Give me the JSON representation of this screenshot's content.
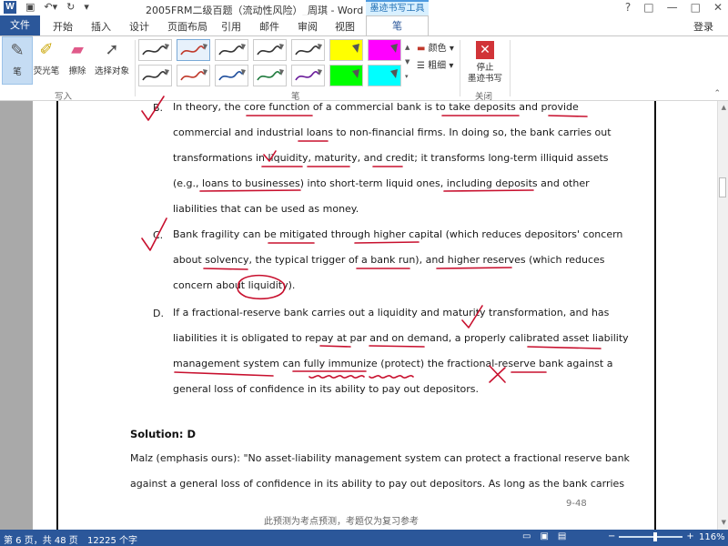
{
  "titlebar": {
    "title": "2005FRM二级百题（流动性风险）_周琪 - Word",
    "context_tool_label": "墨迹书写工具",
    "help": "?",
    "restore": "□",
    "minimize": "—",
    "maximize": "□",
    "close": "✕"
  },
  "tabs": {
    "file": "文件",
    "home": "开始",
    "insert": "插入",
    "design": "设计",
    "layout": "页面布局",
    "references": "引用",
    "mailings": "邮件",
    "review": "审阅",
    "view": "视图",
    "pen": "笔",
    "login": "登录"
  },
  "ribbon": {
    "write_group": {
      "pen": "笔",
      "highlighter": "荧光笔",
      "eraser": "擦除",
      "select_objects": "选择对象",
      "group_label": "写入"
    },
    "pens_group": {
      "color": "颜色",
      "thickness": "粗细",
      "group_label": "笔"
    },
    "close_group": {
      "stop_inking_line1": "停止",
      "stop_inking_line2": "墨迹书写",
      "group_label": "关闭"
    },
    "pen_colors": [
      "#333333",
      "#c0392b",
      "#333333",
      "#333333",
      "#333333",
      "#ffff00",
      "#ff00ff",
      "#333333",
      "#c0392b",
      "#1f4e9c",
      "#1e7a3c",
      "#6a1b9a",
      "#00ff00",
      "#00ffff"
    ]
  },
  "document": {
    "item_b": {
      "letter": "B.",
      "lines": [
        "In theory, the core function of a commercial bank is to take deposits and provide",
        "commercial and industrial loans to non-financial firms. In doing so, the bank carries out",
        "transformations in liquidity, maturity, and credit; it transforms long-term illiquid assets",
        "(e.g., loans to businesses) into short-term liquid ones, including deposits and other",
        "liabilities that can be used as money."
      ]
    },
    "item_c": {
      "letter": "C.",
      "lines": [
        "Bank fragility can be mitigated through higher capital (which reduces depositors' concern",
        "about solvency, the typical trigger of a bank run), and higher reserves (which reduces",
        "concern about liquidity)."
      ]
    },
    "item_d": {
      "letter": "D.",
      "lines": [
        "If a fractional-reserve bank carries out a liquidity and maturity transformation, and has",
        "liabilities it is obligated to repay at par and on demand, a properly calibrated asset liability",
        "management system can fully immunize (protect) the fractional-reserve bank against a",
        "general loss of confidence in its ability to pay out depositors."
      ]
    },
    "solution": "Solution: D",
    "malz_lines": [
      "Malz (emphasis ours): \"No asset-liability management system can protect a fractional reserve bank",
      "against a general loss of confidence in its ability to pay out depositors. As long as the bank carries"
    ],
    "page_number": "9-48",
    "footer": "此预测为考点预测，考题仅为复习参考"
  },
  "statusbar": {
    "page": "第 6 页，共 48 页",
    "words": "12225 个字",
    "zoom": "116%",
    "zoom_minus": "−",
    "zoom_plus": "+"
  },
  "colors": {
    "accent": "#2b579a",
    "ink": "#c8102e"
  }
}
